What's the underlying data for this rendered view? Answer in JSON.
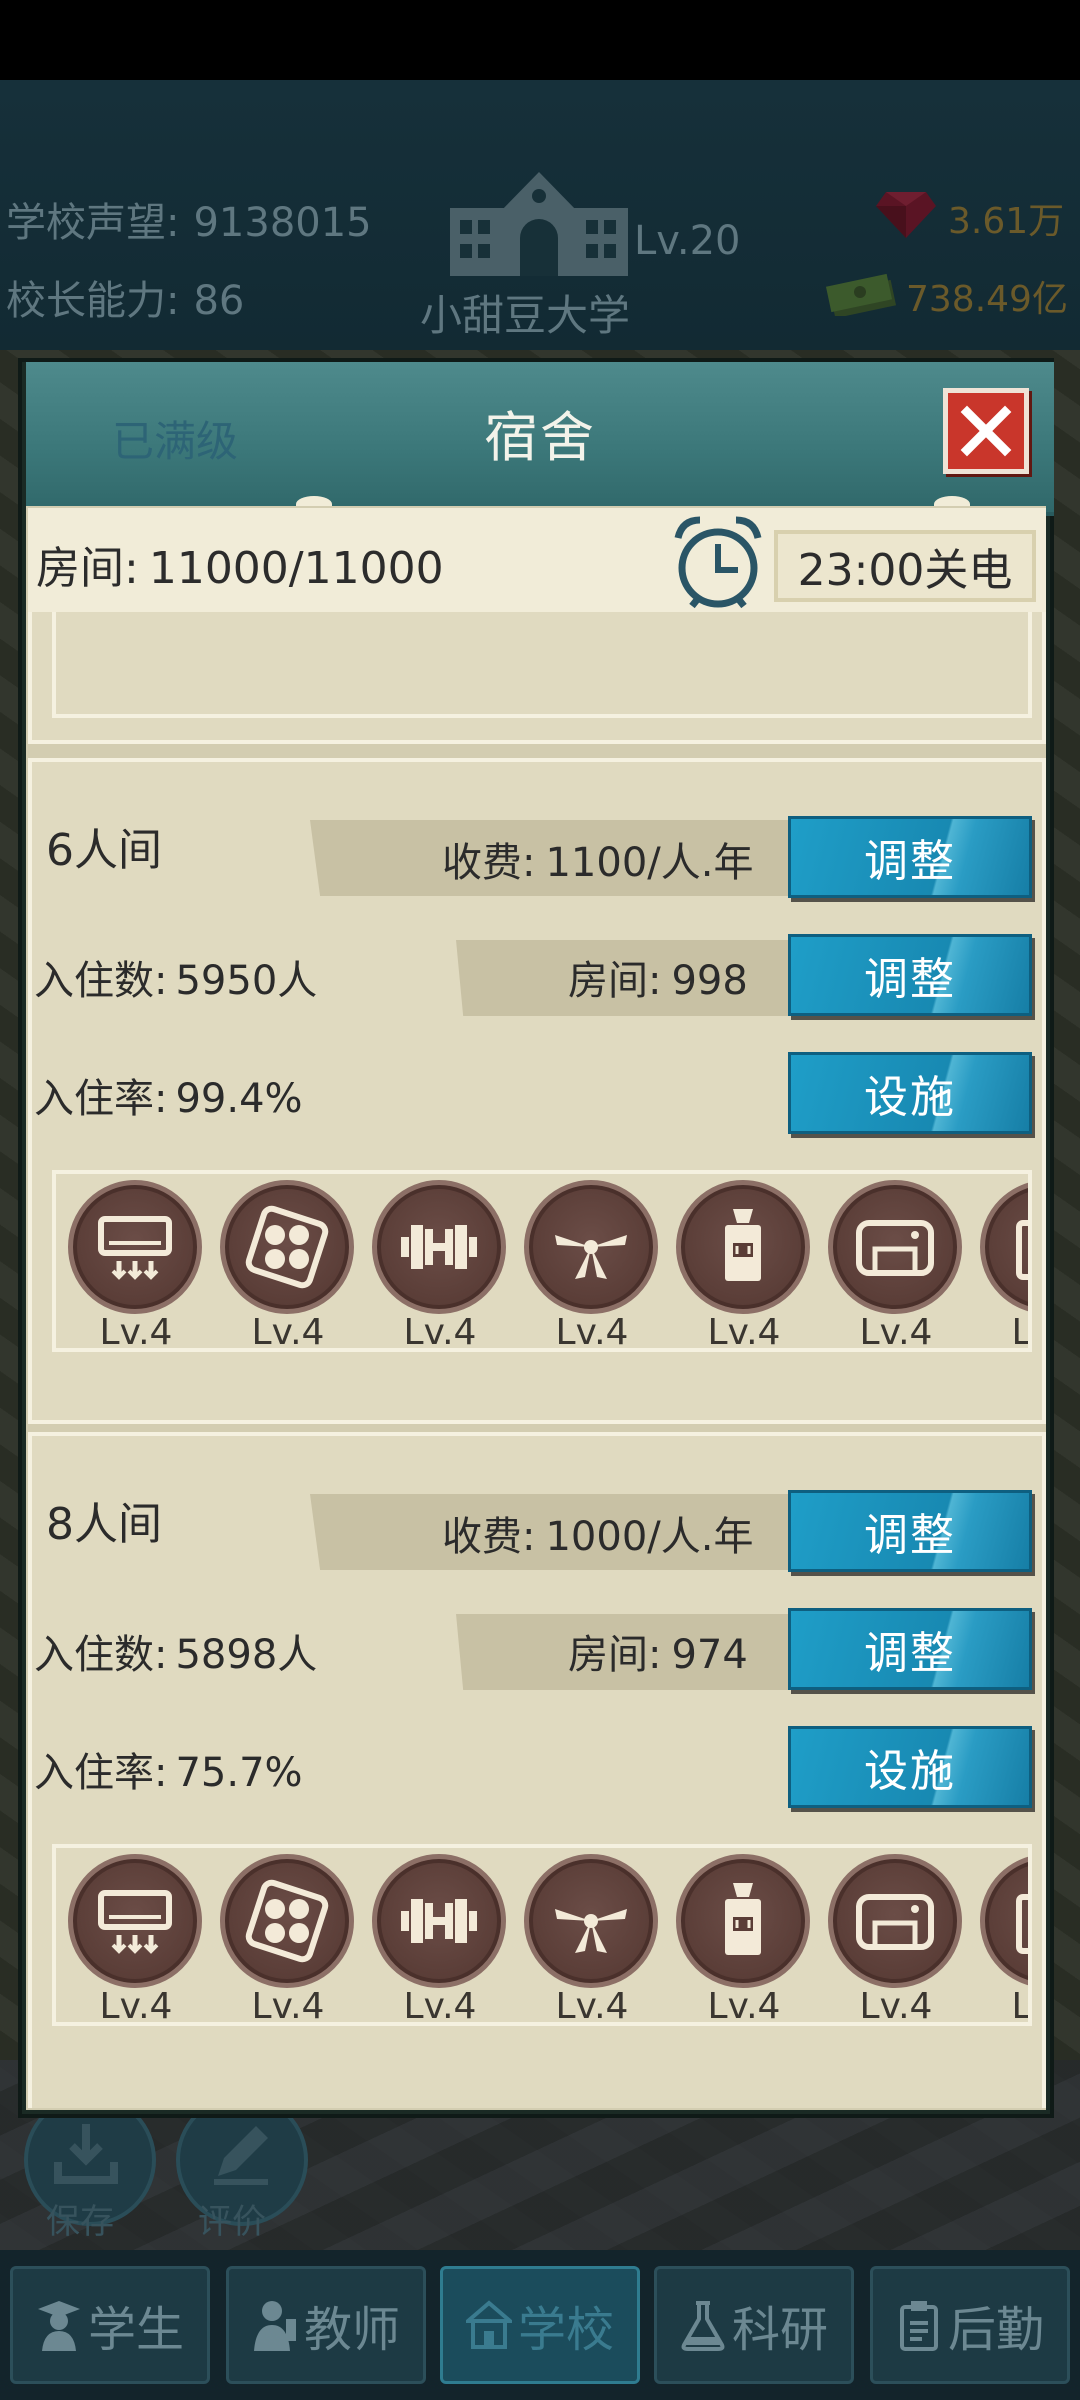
{
  "header": {
    "reputation_label": "学校声望:",
    "reputation_value": "9138015",
    "principal_label": "校长能力:",
    "principal_value": "86",
    "school_level": "Lv.20",
    "school_name": "小甜豆大学",
    "gems": "3.61万",
    "money": "738.49亿"
  },
  "background_buttons": {
    "save": "保存",
    "review": "评价"
  },
  "bottom_nav": [
    {
      "label": "学生",
      "icon": "student-icon"
    },
    {
      "label": "教师",
      "icon": "teacher-icon"
    },
    {
      "label": "学校",
      "icon": "school-icon"
    },
    {
      "label": "科研",
      "icon": "flask-icon"
    },
    {
      "label": "后勤",
      "icon": "clipboard-icon"
    }
  ],
  "dialog": {
    "maxed": "已满级",
    "title": "宿舍",
    "rooms_label": "房间:",
    "rooms_value": "11000/11000",
    "lights_off": "23:00关电"
  },
  "facility_level": "Lv.4",
  "facility_icons": [
    "air-conditioner-icon",
    "four-circles-icon",
    "dumbbell-icon",
    "ceiling-fan-icon",
    "water-dispenser-icon",
    "washing-machine-icon"
  ],
  "room_types": [
    {
      "title": "6人间",
      "fee_label": "收费:",
      "fee_value": "1100/人.年",
      "occupants_label": "入住数:",
      "occupants_value": "5950人",
      "rooms_label": "房间:",
      "rooms_value": "998",
      "rate_label": "入住率:",
      "rate_value": "99.4%",
      "adjust_label": "调整",
      "facility_label": "设施"
    },
    {
      "title": "8人间",
      "fee_label": "收费:",
      "fee_value": "1000/人.年",
      "occupants_label": "入住数:",
      "occupants_value": "5898人",
      "rooms_label": "房间:",
      "rooms_value": "974",
      "rate_label": "入住率:",
      "rate_value": "75.7%",
      "adjust_label": "调整",
      "facility_label": "设施"
    }
  ],
  "colors": {
    "button_blue": "#1b8fb9",
    "panel_beige": "#d3cdb1",
    "close_red": "#c9362b",
    "facility_brown": "#5a3d37"
  }
}
